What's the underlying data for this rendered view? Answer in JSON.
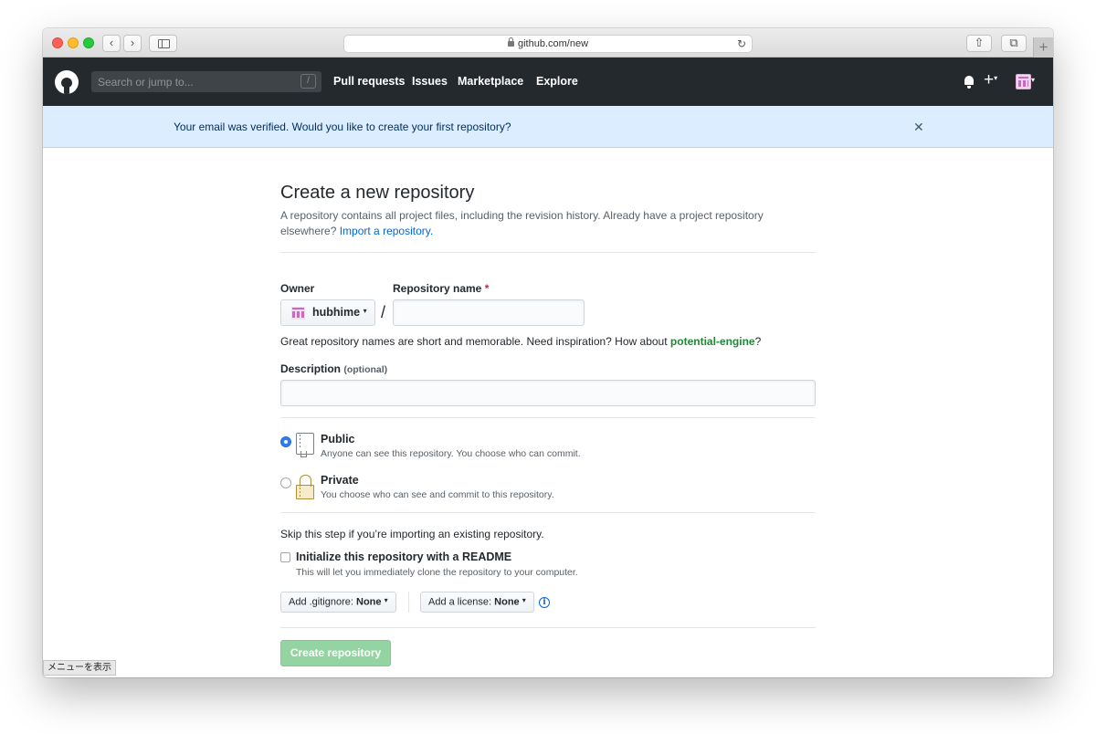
{
  "browser": {
    "url": "github.com/new",
    "reload_symbol": "↻",
    "back_symbol": "‹",
    "forward_symbol": "›",
    "new_tab_symbol": "+",
    "share_symbol": "⇧",
    "tabs_symbol": "⧉",
    "menu_hint": "メニューを表示"
  },
  "header": {
    "search_placeholder": "Search or jump to...",
    "search_key": "/",
    "nav": [
      "Pull requests",
      "Issues",
      "Marketplace",
      "Explore"
    ],
    "plus_symbol": "+",
    "caret": "▾"
  },
  "flash": {
    "message": "Your email was verified. Would you like to create your first repository?",
    "close_symbol": "✕"
  },
  "form": {
    "title": "Create a new repository",
    "description_text": "A repository contains all project files, including the revision history. Already have a project repository elsewhere?",
    "import_link": "Import a repository.",
    "owner_label": "Owner",
    "repo_name_label": "Repository name",
    "required_mark": "*",
    "owner_name": "hubhime",
    "separator": "/",
    "repo_name_value": "",
    "name_hint_prefix": "Great repository names are short and memorable. Need inspiration? How about",
    "name_suggestion": "potential-engine",
    "name_hint_suffix": "?",
    "description_label": "Description",
    "description_optional": "(optional)",
    "description_value": "",
    "visibility": [
      {
        "title": "Public",
        "desc": "Anyone can see this repository. You choose who can commit.",
        "checked": true
      },
      {
        "title": "Private",
        "desc": "You choose who can see and commit to this repository.",
        "checked": false
      }
    ],
    "skip_note": "Skip this step if you’re importing an existing repository.",
    "readme_label": "Initialize this repository with a README",
    "readme_desc": "This will let you immediately clone the repository to your computer.",
    "readme_checked": false,
    "gitignore_prefix": "Add .gitignore:",
    "gitignore_value": "None",
    "license_prefix": "Add a license:",
    "license_value": "None",
    "info_symbol": "i",
    "create_button": "Create repository"
  },
  "colors": {
    "header_bg": "#24292e",
    "flash_bg": "#dbedff",
    "link": "#0366d6",
    "suggestion": "#22863a",
    "create_disabled": "#94d3a2"
  }
}
